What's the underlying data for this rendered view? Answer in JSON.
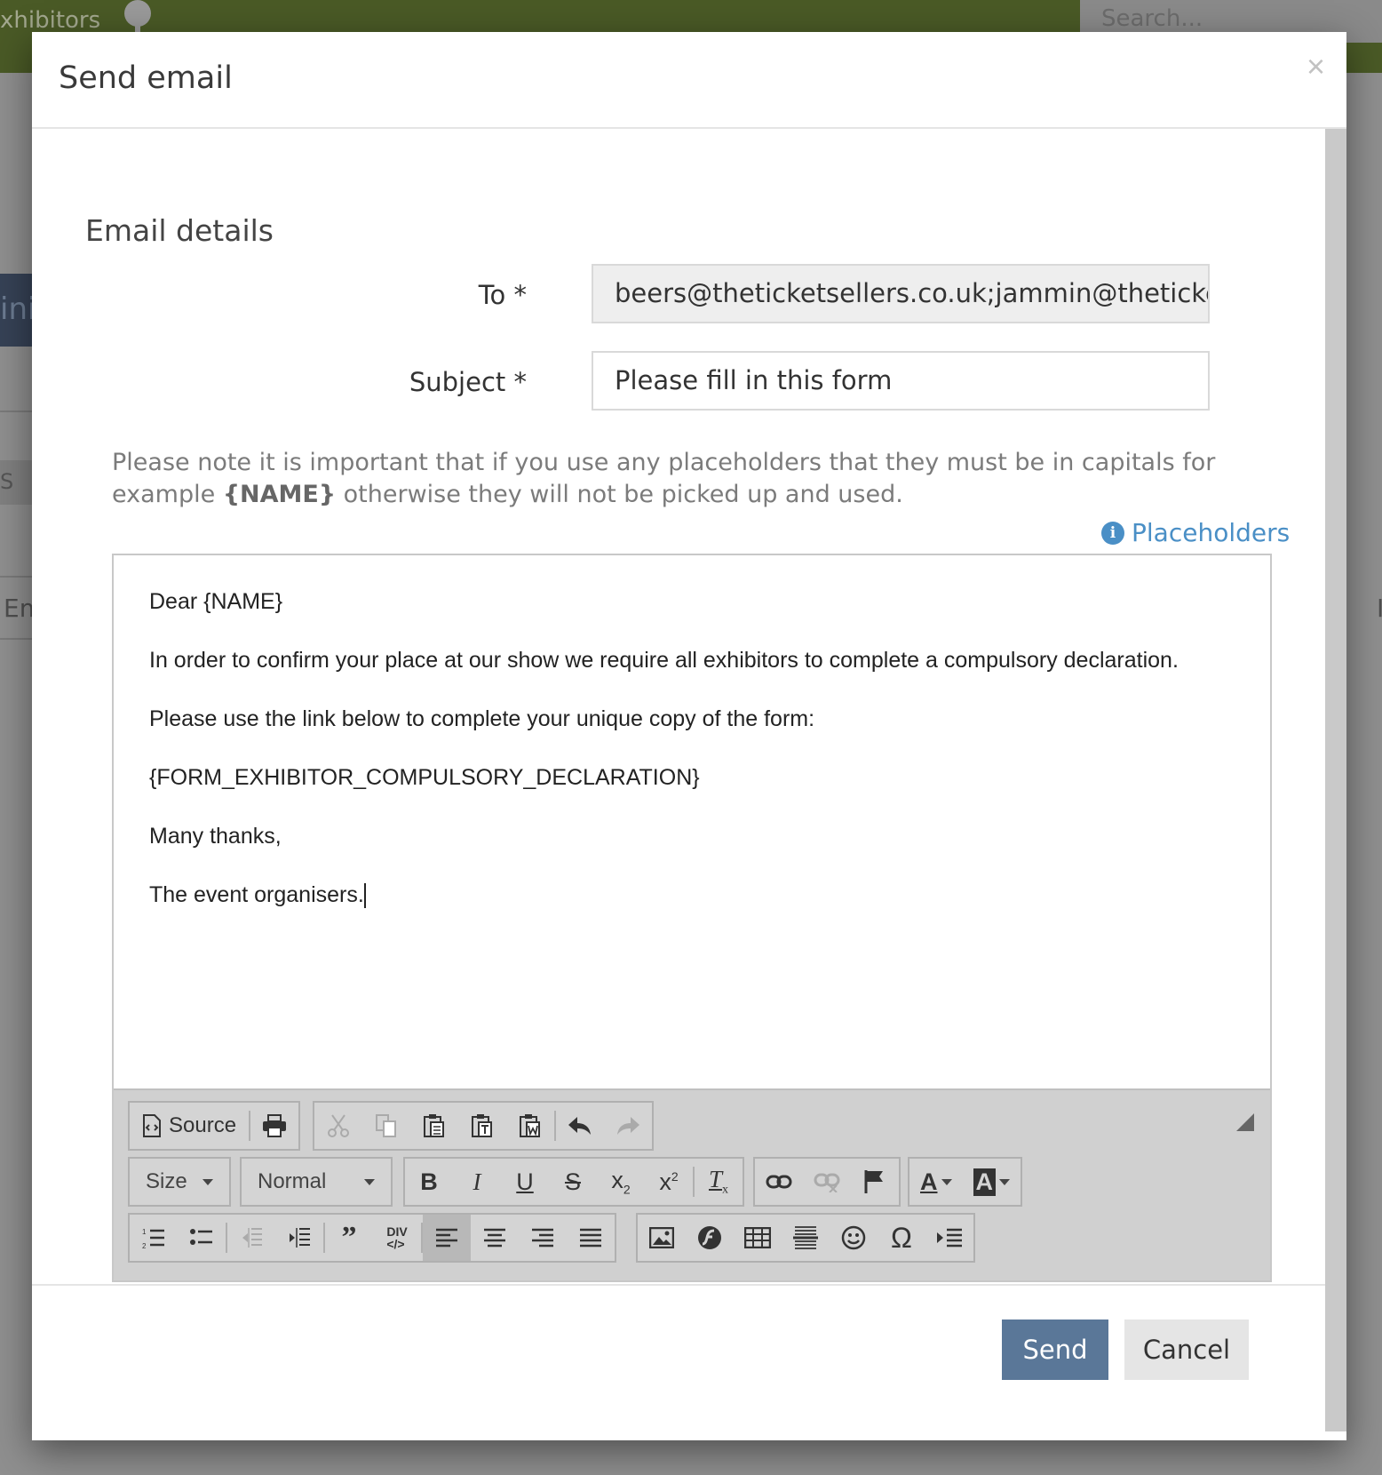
{
  "background": {
    "brand_fragment": "xhibitors",
    "search_placeholder": "Search...",
    "tab_fragment": "ini",
    "chip_fragment": "S",
    "left_text_fragment": "Em",
    "right_text_fragment": "I"
  },
  "modal": {
    "title": "Send email",
    "close_label": "×",
    "section_title": "Email details",
    "to": {
      "label": "To *",
      "value": "beers@theticketsellers.co.uk;jammin@theticketse"
    },
    "subject": {
      "label": "Subject *",
      "value": "Please fill in this form"
    },
    "note_before": "Please note it is important that if you use any placeholders that they must be in capitals for example",
    "note_example": "{NAME}",
    "note_after": "otherwise they will not be picked up and used.",
    "placeholders_link": "Placeholders",
    "editor": {
      "paragraphs": [
        "Dear {NAME}",
        "In order to confirm your place at our show we require all exhibitors to complete a compulsory declaration.",
        "Please use the link below to complete your unique copy of the form:",
        "{FORM_EXHIBITOR_COMPULSORY_DECLARATION}",
        "Many thanks,",
        "The event organisers."
      ],
      "toolbar": {
        "source_label": "Source",
        "size_label": "Size",
        "format_label": "Normal"
      }
    },
    "footer": {
      "send_label": "Send",
      "cancel_label": "Cancel"
    }
  }
}
